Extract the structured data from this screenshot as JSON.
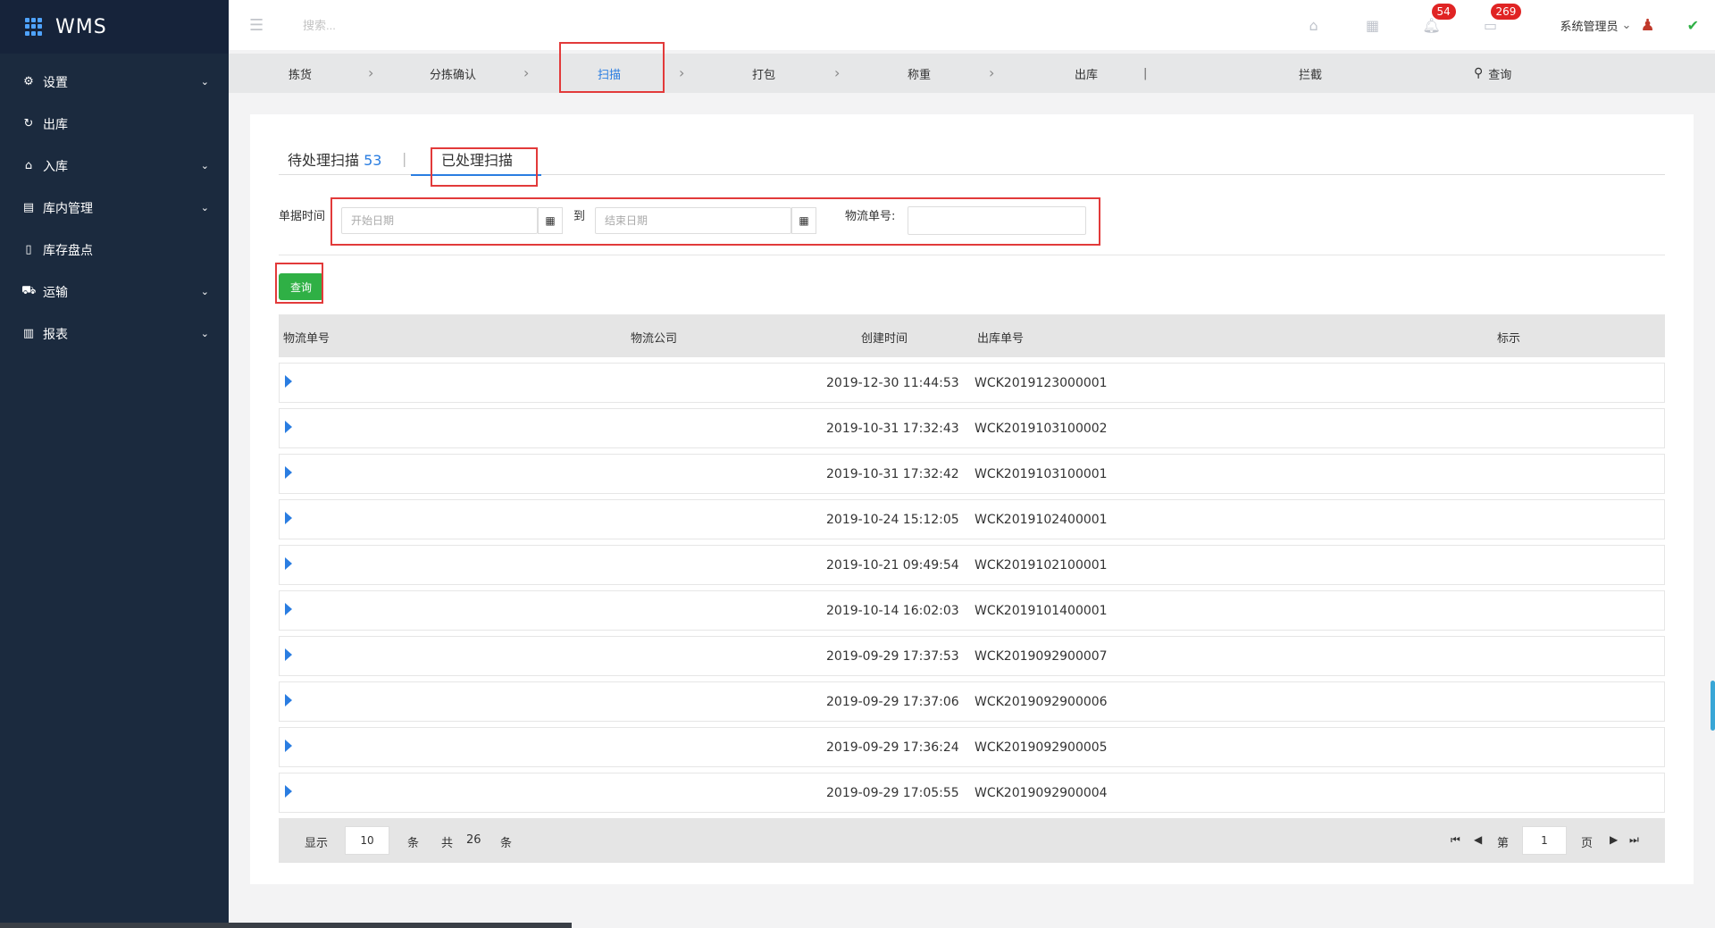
{
  "app": {
    "brand": "WMS"
  },
  "sidebar": {
    "items": [
      {
        "label": "设置",
        "icon": "gear-icon",
        "has_children": true
      },
      {
        "label": "出库",
        "icon": "refresh-icon",
        "has_children": false
      },
      {
        "label": "入库",
        "icon": "home-icon",
        "has_children": true
      },
      {
        "label": "库内管理",
        "icon": "box-icon",
        "has_children": true
      },
      {
        "label": "库存盘点",
        "icon": "document-icon",
        "has_children": false
      },
      {
        "label": "运输",
        "icon": "truck-icon",
        "has_children": true
      },
      {
        "label": "报表",
        "icon": "bar-chart-icon",
        "has_children": true
      }
    ]
  },
  "header": {
    "search_placeholder": "搜索...",
    "notifications_count": "54",
    "messages_count": "269",
    "user_name": "系统管理员"
  },
  "steps": {
    "items": [
      "拣货",
      "分拣确认",
      "扫描",
      "打包",
      "称重",
      "出库",
      "拦截"
    ],
    "active": "扫描",
    "query_label": "查询"
  },
  "tabs": {
    "pending_label": "待处理扫描",
    "pending_count": "53",
    "processed_label": "已处理扫描"
  },
  "filters": {
    "date_label": "单据时间",
    "start_placeholder": "开始日期",
    "to_label": "到",
    "end_placeholder": "结束日期",
    "tracking_label": "物流单号:",
    "query_button": "查询"
  },
  "table": {
    "columns": [
      "物流单号",
      "物流公司",
      "创建时间",
      "出库单号",
      "标示"
    ],
    "rows": [
      {
        "created": "2019-12-30 11:44:53",
        "outbound_no": "WCK2019123000001"
      },
      {
        "created": "2019-10-31 17:32:43",
        "outbound_no": "WCK2019103100002"
      },
      {
        "created": "2019-10-31 17:32:42",
        "outbound_no": "WCK2019103100001"
      },
      {
        "created": "2019-10-24 15:12:05",
        "outbound_no": "WCK2019102400001"
      },
      {
        "created": "2019-10-21 09:49:54",
        "outbound_no": "WCK2019102100001"
      },
      {
        "created": "2019-10-14 16:02:03",
        "outbound_no": "WCK2019101400001"
      },
      {
        "created": "2019-09-29 17:37:53",
        "outbound_no": "WCK2019092900007"
      },
      {
        "created": "2019-09-29 17:37:06",
        "outbound_no": "WCK2019092900006"
      },
      {
        "created": "2019-09-29 17:36:24",
        "outbound_no": "WCK2019092900005"
      },
      {
        "created": "2019-09-29 17:05:55",
        "outbound_no": "WCK2019092900004"
      }
    ]
  },
  "pager": {
    "show_label": "显示",
    "page_size": "10",
    "unit1": "条",
    "total_label": "共",
    "total": "26",
    "unit2": "条",
    "page_prefix": "第",
    "page_value": "1",
    "page_suffix": "页"
  },
  "colors": {
    "sidebar": "#1b2a3e",
    "accent": "#2a7de1",
    "query_button": "#2fb045",
    "highlight": "#e23a3a"
  }
}
